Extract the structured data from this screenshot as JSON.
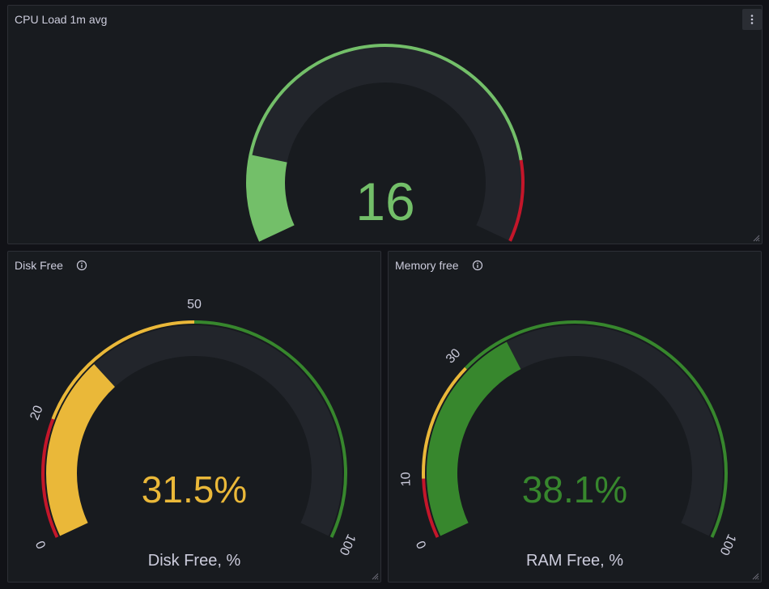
{
  "panels": {
    "cpu": {
      "title": "CPU Load 1m avg",
      "menu_icon": "kebab-menu-icon",
      "gauge": {
        "min": 0,
        "max": 100,
        "value": 16,
        "display": "16",
        "unit_label": "",
        "value_color": "#73bf69",
        "thresholds": [
          {
            "from": 0,
            "to": 85,
            "color": "#73bf69"
          },
          {
            "from": 85,
            "to": 100,
            "color": "#c4162a"
          }
        ],
        "tick_labels": []
      }
    },
    "disk": {
      "title": "Disk Free",
      "info_icon": "info-icon",
      "gauge": {
        "min": 0,
        "max": 100,
        "value": 31.5,
        "display": "31.5%",
        "unit_label": "Disk Free, %",
        "value_color": "#eab839",
        "thresholds": [
          {
            "from": 0,
            "to": 20,
            "color": "#c4162a"
          },
          {
            "from": 20,
            "to": 50,
            "color": "#eab839"
          },
          {
            "from": 50,
            "to": 100,
            "color": "#37872d"
          }
        ],
        "tick_labels": [
          "0",
          "20",
          "50",
          "100"
        ]
      }
    },
    "mem": {
      "title": "Memory free",
      "info_icon": "info-icon",
      "gauge": {
        "min": 0,
        "max": 100,
        "value": 38.1,
        "display": "38.1%",
        "unit_label": "RAM Free, %",
        "value_color": "#37872d",
        "thresholds": [
          {
            "from": 0,
            "to": 10,
            "color": "#c4162a"
          },
          {
            "from": 10,
            "to": 30,
            "color": "#eab839"
          },
          {
            "from": 30,
            "to": 100,
            "color": "#37872d"
          }
        ],
        "tick_labels": [
          "0",
          "10",
          "30",
          "100"
        ]
      }
    }
  },
  "colors": {
    "background": "#111217",
    "panel": "#181b1f",
    "track": "#22252b",
    "title_text": "#ccccdc",
    "tick_text": "#ccccdc"
  }
}
